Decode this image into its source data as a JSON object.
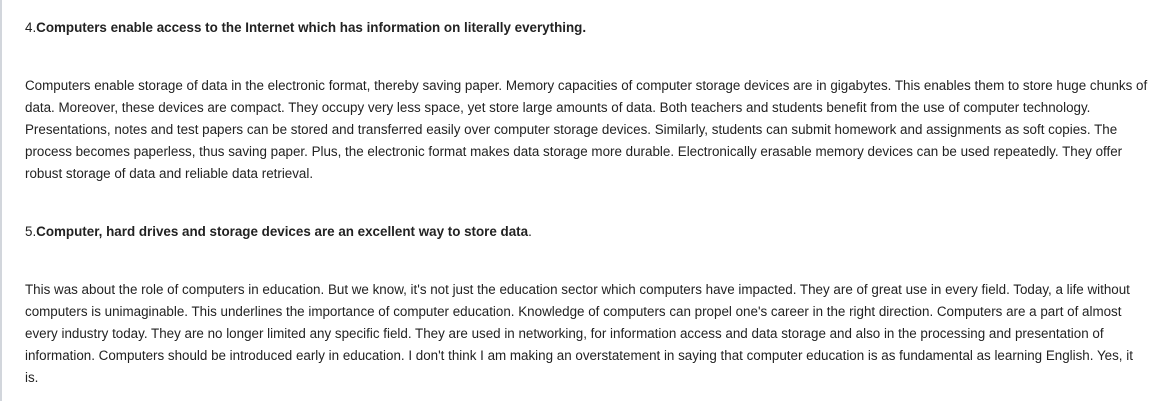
{
  "sections": [
    {
      "heading_number": "4.",
      "heading_text": "Computers enable access to the Internet which has information on literally everything.",
      "heading_suffix": "",
      "paragraph": "Computers enable storage of data in the electronic format, thereby saving paper. Memory capacities of computer storage devices are in gigabytes. This enables them to store huge chunks of data. Moreover, these devices are compact. They occupy very less space, yet store large amounts of data. Both teachers and students benefit from the use of computer technology. Presentations, notes and test papers can be stored and transferred easily over computer storage devices. Similarly, students can submit homework and assignments as soft copies. The process becomes paperless, thus saving paper. Plus, the electronic format makes data storage more durable. Electronically erasable memory devices can be used repeatedly. They offer robust storage of data and reliable data retrieval."
    },
    {
      "heading_number": "5.",
      "heading_text": "Computer, hard drives and storage devices are an excellent way to store data",
      "heading_suffix": ".",
      "paragraph": "This was about the role of computers in education. But we know, it's not just the education sector which computers have impacted. They are of great use in every field. Today, a life without computers is unimaginable. This underlines the importance of computer education. Knowledge of computers can propel one's career in the right direction. Computers are a part of almost every industry today. They are no longer limited any specific field. They are used in networking, for information access and data storage and also in the processing and presentation of information. Computers should be introduced early in education. I don't think I am making an overstatement in saying that computer education is as fundamental as learning English. Yes, it is."
    }
  ]
}
